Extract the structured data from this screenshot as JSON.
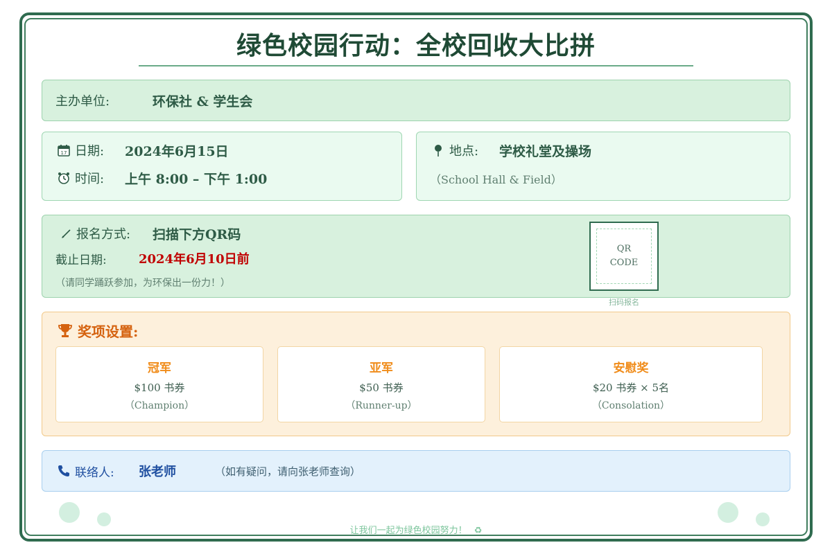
{
  "title": "绿色校园行动：全校回收大比拼",
  "organizer": {
    "label": "主办单位:",
    "value": "环保社 & 学生会"
  },
  "schedule": {
    "date_label": "日期:",
    "date_value": "2024年6月15日",
    "time_label": "时间:",
    "time_value": "上午 8:00 – 下午 1:00",
    "date_icon": "calendar-icon",
    "time_icon": "alarm-clock-icon"
  },
  "location": {
    "label": "地点:",
    "value": "学校礼堂及操场",
    "english": "（School Hall & Field）",
    "icon": "pin-icon"
  },
  "registration": {
    "label": "报名方式:",
    "value": "扫描下方QR码",
    "deadline_label": "截止日期:",
    "deadline_value": "2024年6月10日前",
    "note": "（请同学踊跃参加，为环保出一份力！）",
    "qr_line1": "QR",
    "qr_line2": "CODE",
    "qr_caption": "扫码报名",
    "icon": "pencil-icon"
  },
  "prizes": {
    "heading": "奖项设置:",
    "icon": "trophy-icon",
    "items": [
      {
        "title": "冠军",
        "amount": "$100 书券",
        "english": "（Champion）"
      },
      {
        "title": "亚军",
        "amount": "$50 书券",
        "english": "（Runner-up）"
      },
      {
        "title": "安慰奖",
        "amount": "$20 书券 × 5名",
        "english": "（Consolation）"
      }
    ]
  },
  "contact": {
    "label": "联络人:",
    "value": "张老师",
    "note": "（如有疑问，请向张老师查询）",
    "icon": "phone-icon"
  },
  "footer": "让我们一起为绿色校园努力！",
  "footer_icon": "recycle-icon",
  "colors": {
    "primary": "#2f6b4f",
    "deadline": "#c00000",
    "prize": "#f08c1a",
    "heading_orange": "#d5620f",
    "contact_blue": "#1f4fa0"
  }
}
